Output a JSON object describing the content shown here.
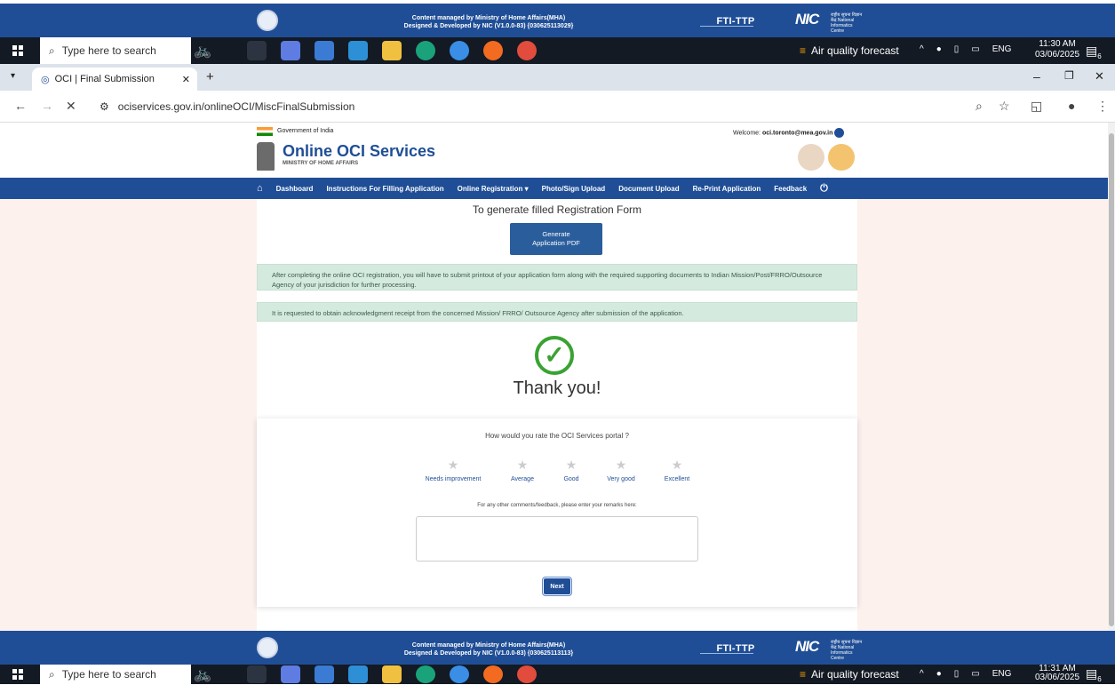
{
  "footer": {
    "line1": "Content managed by Ministry of Home Affairs(MHA)",
    "line2_top": "Designed & Developed by NIC (V1.0.0-83) {030625113029}",
    "line2_bottom": "Designed & Developed by NIC (V1.0.0-83) {030625113113}",
    "fti": "FTI-TTP",
    "nic": "NIC",
    "nic_sub": "राष्ट्रीय सूचना विज्ञान केंद्र National Informatics Centre"
  },
  "taskbar": {
    "search_placeholder": "Type here to search",
    "weather": "Air quality forecast",
    "lang": "ENG",
    "time_top": "11:30 AM",
    "time_bottom": "11:31 AM",
    "date": "03/06/2025",
    "notif_count": "6"
  },
  "browser": {
    "tab_title": "OCI | Final Submission",
    "url": "ociservices.gov.in/onlineOCI/MiscFinalSubmission"
  },
  "site": {
    "gov_label": "Government of India",
    "welcome_label": "Welcome:",
    "user_email": "oci.toronto@mea.gov.in",
    "title": "Online OCI Services",
    "subtitle": "MINISTRY OF HOME AFFAIRS",
    "nav": [
      "Dashboard",
      "Instructions For Filling Application",
      "Online Registration ▾",
      "Photo/Sign Upload",
      "Document Upload",
      "Re-Print Application",
      "Feedback"
    ]
  },
  "main": {
    "generate_heading": "To generate filled Registration Form",
    "generate_button": "Generate Application PDF",
    "alert1": "After completing the online OCI registration, you will have to submit printout of your application form along with the required supporting documents to Indian Mission/Post/FRRO/Outsource Agency of your jurisdiction for further processing.",
    "alert2": "It is requested to obtain acknowledgment receipt from the concerned Mission/ FRRO/ Outsource Agency after submission of the application.",
    "thank_you": "Thank you!",
    "rate_question": "How would you rate the OCI Services portal ?",
    "ratings": [
      "Needs improvement",
      "Average",
      "Good",
      "Very good",
      "Excellent"
    ],
    "comments_label": "For any other comments/feedback, please enter your remarks here:",
    "next_button": "Next"
  },
  "colors": {
    "nav_blue": "#1f4e96",
    "alert_green": "#d4eadf",
    "check_green": "#3aa233"
  }
}
